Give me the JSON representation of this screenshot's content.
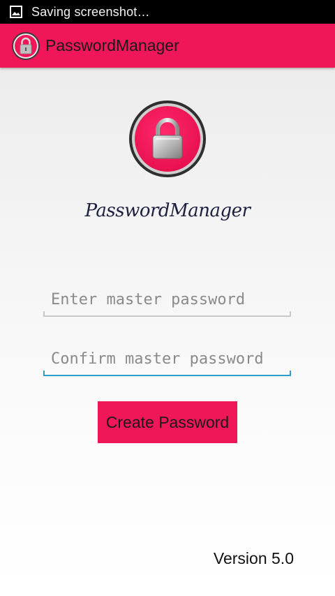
{
  "status_bar": {
    "notification_icon": "image-icon",
    "text": "Saving screenshot…"
  },
  "action_bar": {
    "icon": "lock-icon",
    "title": "PasswordManager"
  },
  "logo": {
    "icon": "lock-icon",
    "brand_text": "PasswordManager"
  },
  "form": {
    "master_password": {
      "placeholder": "Enter master password",
      "value": ""
    },
    "confirm_password": {
      "placeholder": "Confirm master password",
      "value": ""
    },
    "submit_label": "Create Password"
  },
  "footer": {
    "version": "Version 5.0"
  },
  "colors": {
    "accent": "#f01758",
    "focus_line": "#2f9cc9",
    "status_bar": "#000000"
  }
}
